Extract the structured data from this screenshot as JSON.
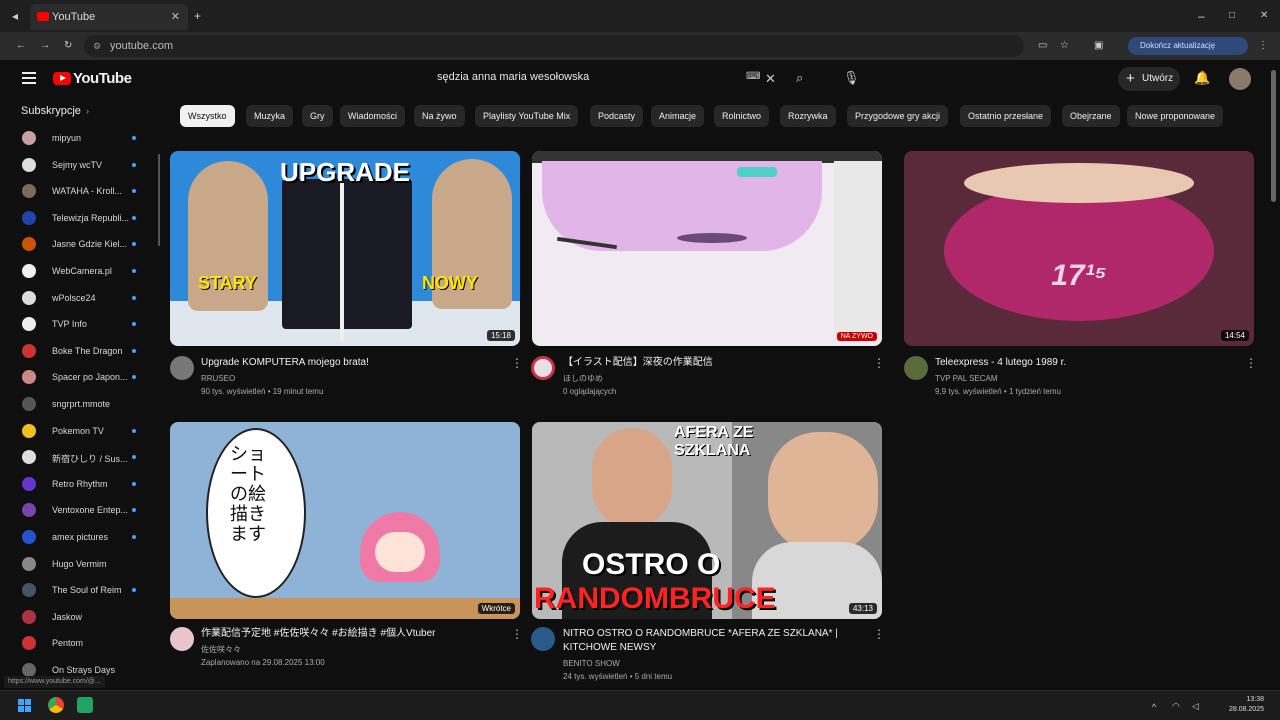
{
  "browser": {
    "tab_title": "YouTube",
    "url": "youtube.com",
    "profile_label": "Dokończ aktualizację",
    "status_url": "https://www.youtube.com/@..."
  },
  "header": {
    "logo": "YouTube",
    "search_query": "sędzia anna maria wesołowska",
    "create_label": "Utwórz"
  },
  "sidebar": {
    "title": "Subskrypcje",
    "items": [
      {
        "label": "mipyun",
        "color": "#c8a0a0",
        "dot": true
      },
      {
        "label": "Sejmy wcTV",
        "color": "#ddd",
        "dot": true
      },
      {
        "label": "WATAHA - Kroll...",
        "color": "#7a6a5a",
        "dot": true
      },
      {
        "label": "Telewizja Republi...",
        "color": "#2244aa",
        "dot": true
      },
      {
        "label": "Jasne Gdzie Kiel...",
        "color": "#cc5500",
        "dot": true
      },
      {
        "label": "WebCamera.pl",
        "color": "#eee",
        "dot": true
      },
      {
        "label": "wPolsce24",
        "color": "#ddd",
        "dot": true
      },
      {
        "label": "TVP Info",
        "color": "#eee",
        "dot": true
      },
      {
        "label": "Boke The Dragon",
        "color": "#cc3333",
        "dot": true
      },
      {
        "label": "Spacer po Japon...",
        "color": "#cc8888",
        "dot": true
      },
      {
        "label": "sngrprt.mmote",
        "color": "#555",
        "dot": false
      },
      {
        "label": "Pokemon TV",
        "color": "#f0c020",
        "dot": true
      },
      {
        "label": "新宿ひしり / Sus...",
        "color": "#ddd",
        "dot": true
      },
      {
        "label": "Retro Rhythm",
        "color": "#6633cc",
        "dot": true
      },
      {
        "label": "Ventoxone Entep...",
        "color": "#7744aa",
        "dot": true
      },
      {
        "label": "amex pictures",
        "color": "#2255cc",
        "dot": true
      },
      {
        "label": "Hugo Vermim",
        "color": "#888",
        "dot": false
      },
      {
        "label": "The Soul of Reim",
        "color": "#445566",
        "dot": true
      },
      {
        "label": "Jaskow",
        "color": "#aa3344",
        "dot": false
      },
      {
        "label": "Pentom",
        "color": "#cc3333",
        "dot": false
      },
      {
        "label": "On Strays Days",
        "color": "#666",
        "dot": false
      }
    ]
  },
  "chips": [
    "Wszystko",
    "Muzyka",
    "Gry",
    "Wiadomości",
    "Na żywo",
    "Playlisty YouTube Mix",
    "Podcasty",
    "Animacje",
    "Rolnictwo",
    "Rozrywka",
    "Przygodowe gry akcji",
    "Ostatnio przesłane",
    "Obejrzane",
    "Nowe proponowane"
  ],
  "videos": [
    {
      "title": "Upgrade KOMPUTERA mojego brata!",
      "channel": "RRUSEO",
      "meta": "90 tys. wyświetleń • 19 minut temu",
      "duration": "15:18",
      "thumb_text": "UPGRADE",
      "thumb_left": "STARY",
      "thumb_right": "NOWY"
    },
    {
      "title": "【イラスト配信】深夜の作業配信",
      "channel": "ほしのゆめ",
      "meta": "0 oglądających",
      "badge": "NA ŻYWO"
    },
    {
      "title": "Teleexpress - 4 lutego 1989 r.",
      "channel": "TVP PAL SECAM",
      "meta": "9,9 tys. wyświetleń • 1 tydzień temu",
      "duration": "14:54",
      "thumb_text": "17¹⁵"
    },
    {
      "title": "作業配信予定地 #佐佐咲々々 #お絵描き #個人Vtuber",
      "channel": "佐佐咲々々",
      "meta": "Zaplanowano na 29.08.2025 13:00",
      "duration": "Wkrótce",
      "thumb_text": "ショートの絵 描きます"
    },
    {
      "title": "NITRO OSTRO O RANDOMBRUCE *AFERA ZE SZKLANA* | KITCHOWE NEWSY",
      "channel": "BENITO SHOW",
      "meta": "24 tys. wyświetleń • 5 dni temu",
      "duration": "43:13",
      "thumb_top": "AFERA ZE SZKLANA",
      "thumb_mid": "OSTRO O",
      "thumb_bot": "RANDOMBRUCE"
    }
  ],
  "taskbar": {
    "time": "13:38",
    "date": "28.08.2025"
  }
}
